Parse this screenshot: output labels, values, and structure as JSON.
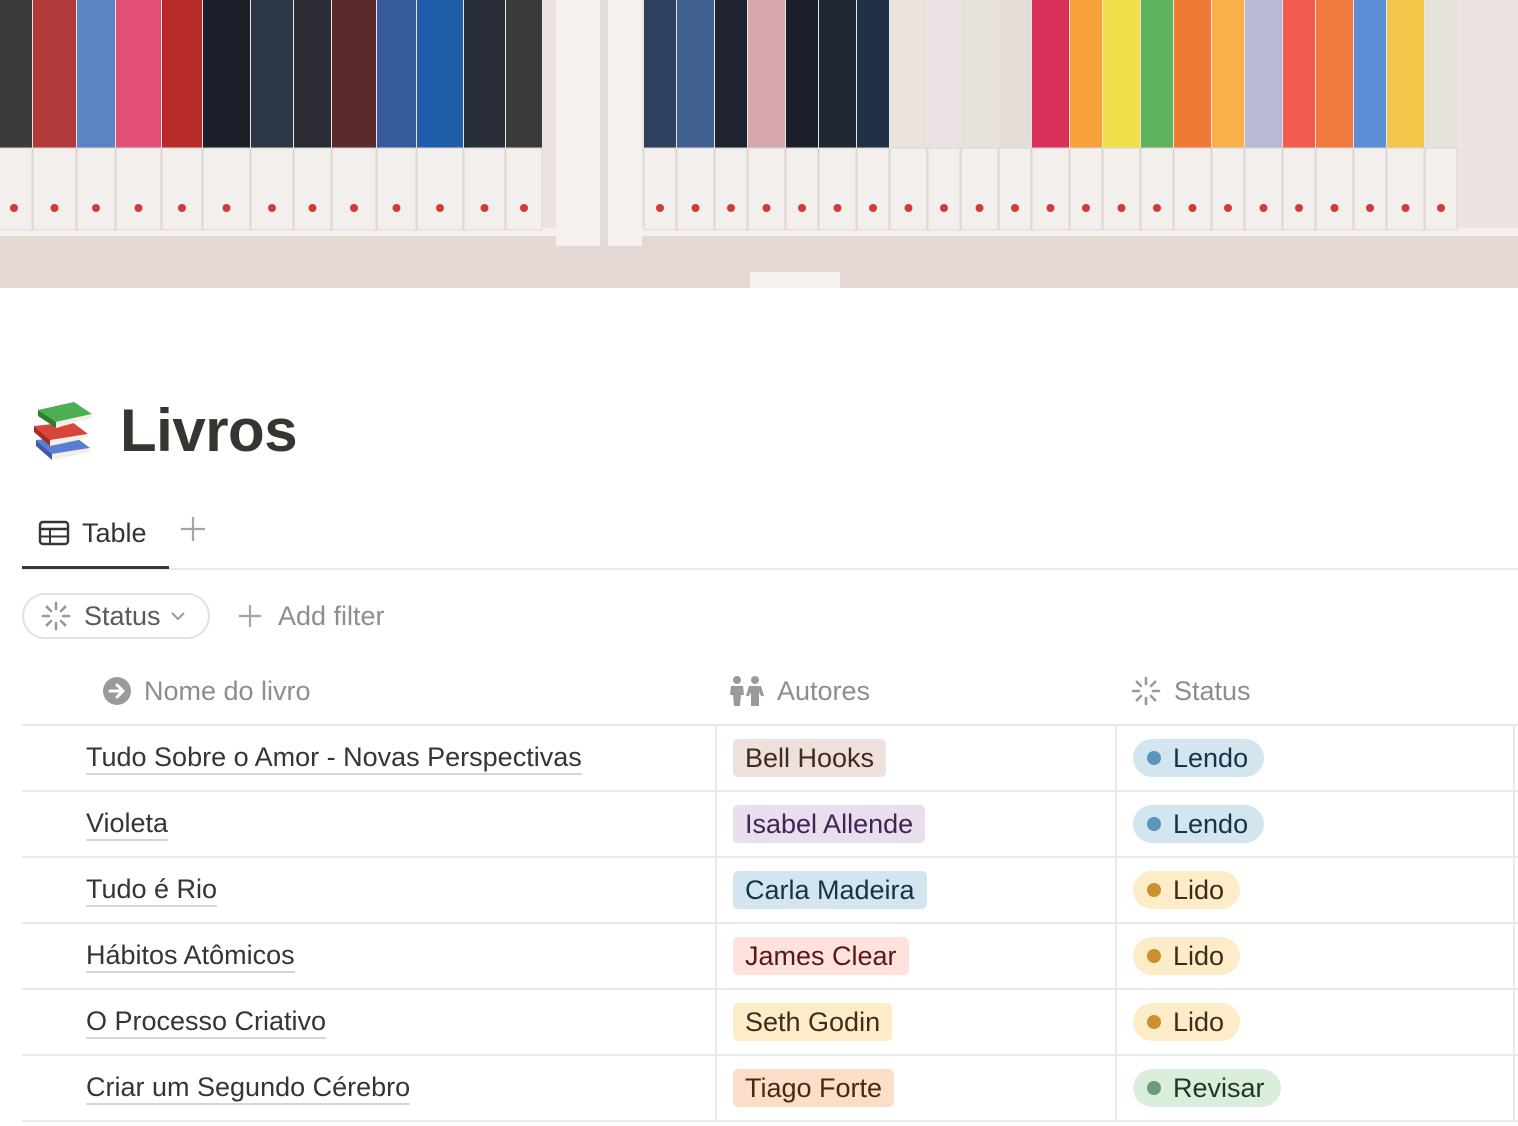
{
  "page": {
    "title": "Livros",
    "icon": "books-icon"
  },
  "views": {
    "tabs": [
      {
        "label": "Table",
        "icon": "table-icon"
      }
    ],
    "add_icon": "plus-icon"
  },
  "filters": {
    "chip_label": "Status",
    "chip_icon": "status-loader-icon",
    "add_filter_label": "Add filter"
  },
  "table": {
    "columns": [
      {
        "label": "Nome do livro",
        "icon": "title-arrow-icon"
      },
      {
        "label": "Autores",
        "icon": "people-icon"
      },
      {
        "label": "Status",
        "icon": "status-loader-icon"
      }
    ],
    "rows": [
      {
        "name": "Tudo Sobre o Amor - Novas Perspectivas",
        "author": "Bell Hooks",
        "status": "Lendo"
      },
      {
        "name": "Violeta",
        "author": "Isabel Allende",
        "status": "Lendo"
      },
      {
        "name": "Tudo é Rio",
        "author": "Carla Madeira",
        "status": "Lido"
      },
      {
        "name": "Hábitos Atômicos",
        "author": "James Clear",
        "status": "Lido"
      },
      {
        "name": "O Processo Criativo",
        "author": "Seth Godin",
        "status": "Lido"
      },
      {
        "name": "Criar um Segundo Cérebro",
        "author": "Tiago Forte",
        "status": "Revisar"
      }
    ]
  },
  "colors": {
    "text": "#37352f",
    "muted": "#8e8d8a",
    "border": "#e9e9e7",
    "author_tags": {
      "Bell Hooks": {
        "bg": "#eee0da",
        "fg": "#442a1e"
      },
      "Isabel Allende": {
        "bg": "#e8deee",
        "fg": "#412454"
      },
      "Carla Madeira": {
        "bg": "#d3e5ef",
        "fg": "#183347"
      },
      "James Clear": {
        "bg": "#ffe2dd",
        "fg": "#5d1715"
      },
      "Seth Godin": {
        "bg": "#fdecc8",
        "fg": "#402c1b"
      },
      "Tiago Forte": {
        "bg": "#fadec9",
        "fg": "#49290e"
      }
    },
    "status": {
      "Lendo": {
        "bg": "#d3e5ef",
        "dot": "#5b97bd",
        "fg": "#183347"
      },
      "Lido": {
        "bg": "#fdecc8",
        "dot": "#cb912f",
        "fg": "#402c1b"
      },
      "Revisar": {
        "bg": "#dbeddb",
        "dot": "#6c9b7d",
        "fg": "#1c3829"
      }
    }
  }
}
